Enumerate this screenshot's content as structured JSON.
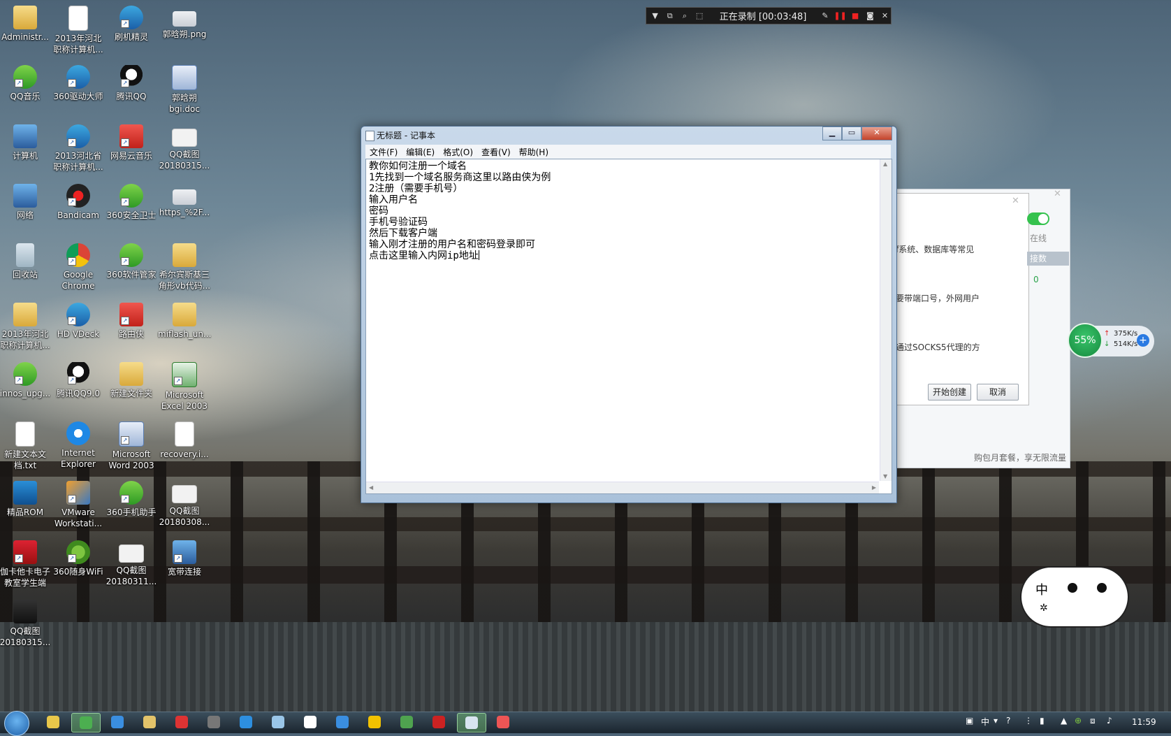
{
  "desktop_icons": [
    {
      "label": "Administr...",
      "icon": "user-folder-icon",
      "kind": "k-folder",
      "shortcut": false
    },
    {
      "label": "2013年河北\n职称计算机...",
      "icon": "text-file-icon",
      "kind": "k-file",
      "shortcut": false
    },
    {
      "label": "刷机精灵",
      "icon": "flash-wizard-icon",
      "kind": "k-app",
      "shortcut": true
    },
    {
      "label": "郭晗朔.png",
      "icon": "png-image-icon",
      "kind": "k-img",
      "shortcut": false
    },
    {
      "label": "QQ音乐",
      "icon": "qq-music-icon",
      "kind": "k-green",
      "shortcut": true
    },
    {
      "label": "360驱动大师",
      "icon": "driver-master-icon",
      "kind": "k-app",
      "shortcut": true
    },
    {
      "label": "腾讯QQ",
      "icon": "qq-penguin-icon",
      "kind": "k-qq",
      "shortcut": true
    },
    {
      "label": "郭晗朔\nbgi.doc",
      "icon": "word-doc-icon",
      "kind": "k-word",
      "shortcut": false
    },
    {
      "label": "计算机",
      "icon": "computer-icon",
      "kind": "k-pc",
      "shortcut": false
    },
    {
      "label": "2013河北省\n职称计算机...",
      "icon": "exam-app-icon",
      "kind": "k-app",
      "shortcut": true
    },
    {
      "label": "网易云音乐",
      "icon": "netease-music-icon",
      "kind": "k-red",
      "shortcut": true
    },
    {
      "label": "QQ截图\n20180315...",
      "icon": "screenshot-image-icon",
      "kind": "k-qqshot",
      "shortcut": false
    },
    {
      "label": "网络",
      "icon": "network-icon",
      "kind": "k-pc",
      "shortcut": false
    },
    {
      "label": "Bandicam",
      "icon": "bandicam-icon",
      "kind": "k-cam",
      "shortcut": true
    },
    {
      "label": "360安全卫士",
      "icon": "360-security-icon",
      "kind": "k-green",
      "shortcut": true
    },
    {
      "label": "https_%2F...",
      "icon": "image-file-icon",
      "kind": "k-img",
      "shortcut": false
    },
    {
      "label": "回收站",
      "icon": "recycle-bin-icon",
      "kind": "k-trash",
      "shortcut": false
    },
    {
      "label": "Google\nChrome",
      "icon": "chrome-icon",
      "kind": "k-chrome",
      "shortcut": true
    },
    {
      "label": "360软件管家",
      "icon": "software-manager-icon",
      "kind": "k-green",
      "shortcut": true
    },
    {
      "label": "希尔宾斯基三\n角形vb代码...",
      "icon": "zip-folder-icon",
      "kind": "k-folder",
      "shortcut": false
    },
    {
      "label": "2013年河北\n职称计算机...",
      "icon": "folder-icon",
      "kind": "k-folder",
      "shortcut": false
    },
    {
      "label": "HD VDeck",
      "icon": "hd-vdeck-icon",
      "kind": "k-app",
      "shortcut": true
    },
    {
      "label": "路由侠",
      "icon": "router-house-icon",
      "kind": "k-red",
      "shortcut": true
    },
    {
      "label": "miflash_un...",
      "icon": "folder-icon",
      "kind": "k-folder",
      "shortcut": false
    },
    {
      "label": "innos_upg...",
      "icon": "installer-icon",
      "kind": "k-green",
      "shortcut": true
    },
    {
      "label": "腾讯QQ9.0",
      "icon": "qq-penguin-icon",
      "kind": "k-qq",
      "shortcut": true
    },
    {
      "label": "新建文件夹",
      "icon": "folder-icon",
      "kind": "k-folder",
      "shortcut": false
    },
    {
      "label": "Microsoft\nExcel 2003",
      "icon": "excel-icon",
      "kind": "k-excel",
      "shortcut": true
    },
    {
      "label": "新建文本文\n档.txt",
      "icon": "text-file-icon",
      "kind": "k-file",
      "shortcut": false
    },
    {
      "label": "Internet\nExplorer",
      "icon": "ie-icon",
      "kind": "k-ie",
      "shortcut": false
    },
    {
      "label": "Microsoft\nWord 2003",
      "icon": "word-icon",
      "kind": "k-word",
      "shortcut": true
    },
    {
      "label": "recovery.i...",
      "icon": "disc-image-icon",
      "kind": "k-file",
      "shortcut": false
    },
    {
      "label": "精品ROM",
      "icon": "rom-icon",
      "kind": "k-rom",
      "shortcut": false
    },
    {
      "label": "VMware\nWorkstati...",
      "icon": "vmware-icon",
      "kind": "k-vm",
      "shortcut": true
    },
    {
      "label": "360手机助手",
      "icon": "phone-assistant-icon",
      "kind": "k-green",
      "shortcut": true
    },
    {
      "label": "QQ截图\n20180308...",
      "icon": "screenshot-image-icon",
      "kind": "k-qqshot",
      "shortcut": false
    },
    {
      "label": "伽卡他卡电子\n教室学生端",
      "icon": "classroom-icon",
      "kind": "k-guitar",
      "shortcut": true
    },
    {
      "label": "360随身WiFi",
      "icon": "wifi-icon",
      "kind": "k-wifi",
      "shortcut": true
    },
    {
      "label": "QQ截图\n20180311...",
      "icon": "screenshot-image-icon",
      "kind": "k-qqshot",
      "shortcut": false
    },
    {
      "label": "宽带连接",
      "icon": "broadband-icon",
      "kind": "k-pc",
      "shortcut": true
    },
    {
      "label": "QQ截图\n20180315...",
      "icon": "phone-screenshot-icon",
      "kind": "k-dark",
      "shortcut": false
    }
  ],
  "recorder": {
    "status": "正在录制 [00:03:48]"
  },
  "notepad": {
    "title": "无标题 - 记事本",
    "menu": [
      "文件(F)",
      "编辑(E)",
      "格式(O)",
      "查看(V)",
      "帮助(H)"
    ],
    "lines": [
      "教你如何注册一个域名",
      "1先找到一个域名服务商这里以路由侠为例",
      "2注册（需要手机号）",
      "输入用户名",
      "密码",
      "手机号验证码",
      "然后下载客户端",
      "输入刚才注册的用户名和密码登录即可",
      "点击这里输入内网ip地址"
    ]
  },
  "background_dialog": {
    "online_label": "在线",
    "text_1": "f系统、数据库等常见",
    "column_header": "接数",
    "column_value": "0",
    "text_2": "要带端口号，外网用户",
    "text_3": "通过SOCKS5代理的方",
    "create_button": "开始创建",
    "cancel_button": "取消",
    "footer": "购包月套餐，享无限流量"
  },
  "network_widget": {
    "percent": "55%",
    "upload": "375K/s",
    "download": "514K/s"
  },
  "sticker": {
    "text": "中"
  },
  "taskbar": {
    "ime": "中",
    "time": "11:59"
  }
}
